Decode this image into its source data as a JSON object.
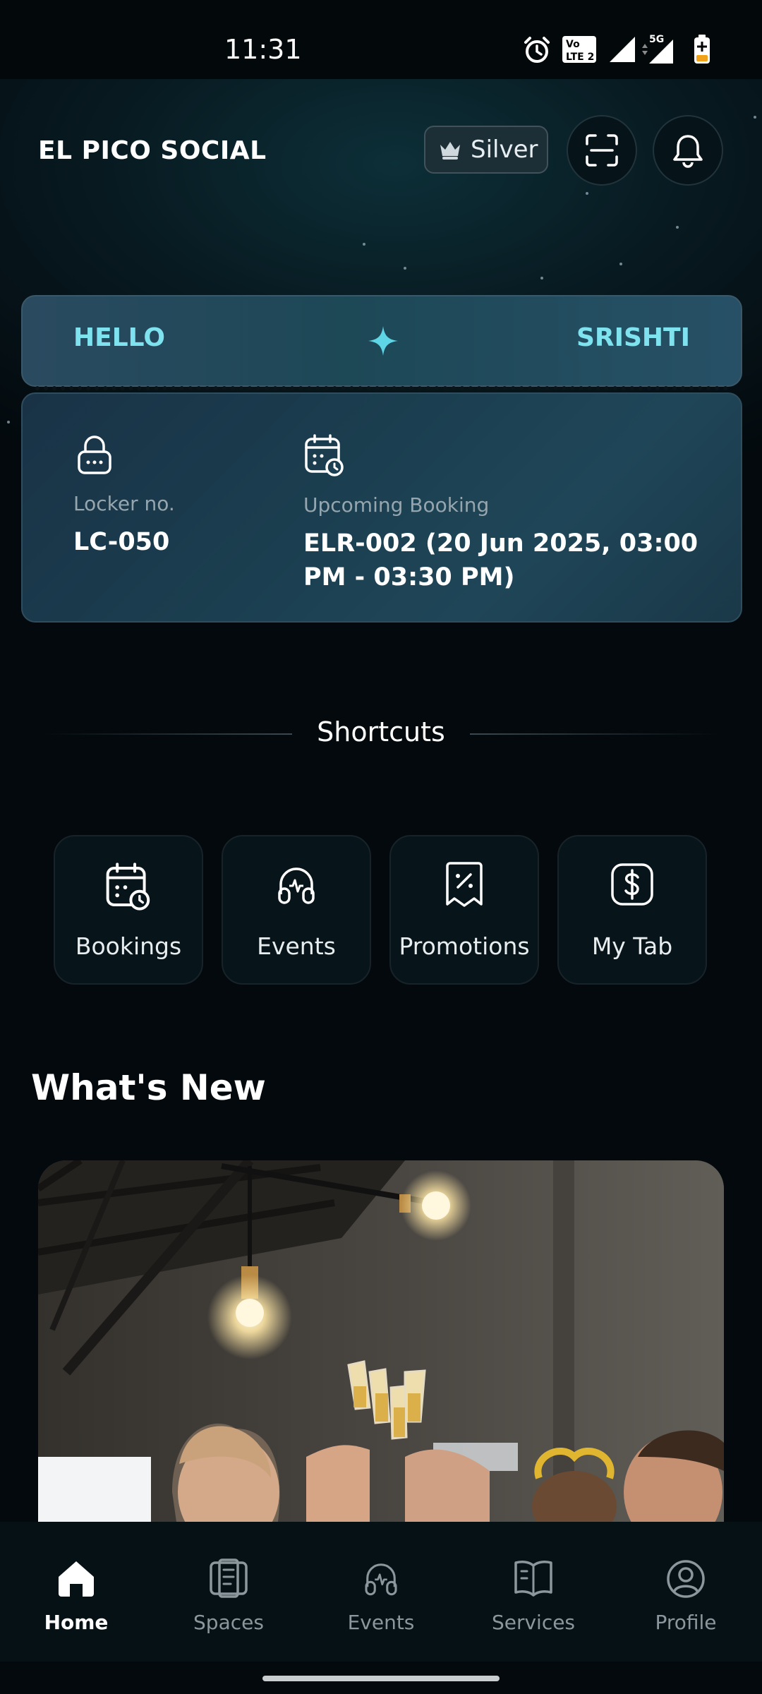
{
  "status_bar": {
    "time": "11:31",
    "network": "5G",
    "volte": "Vo LTE 2"
  },
  "header": {
    "brand": "EL PICO SOCIAL",
    "tier_label": "Silver"
  },
  "greeting": {
    "hello": "HELLO",
    "name": "SRISHTI"
  },
  "info": {
    "locker_label": "Locker no.",
    "locker_value": "LC-050",
    "booking_label": "Upcoming Booking",
    "booking_value": "ELR-002 (20 Jun 2025, 03:00 PM - 03:30 PM)"
  },
  "shortcuts": {
    "title": "Shortcuts",
    "items": [
      {
        "label": "Bookings",
        "icon": "calendar-clock-icon"
      },
      {
        "label": "Events",
        "icon": "events-icon"
      },
      {
        "label": "Promotions",
        "icon": "discount-ticket-icon"
      },
      {
        "label": "My Tab",
        "icon": "dollar-icon"
      }
    ]
  },
  "whats_new": {
    "title": "What's New"
  },
  "bottom_nav": {
    "items": [
      {
        "label": "Home",
        "icon": "home-icon",
        "active": true
      },
      {
        "label": "Spaces",
        "icon": "spaces-icon",
        "active": false
      },
      {
        "label": "Events",
        "icon": "events-icon",
        "active": false
      },
      {
        "label": "Services",
        "icon": "book-icon",
        "active": false
      },
      {
        "label": "Profile",
        "icon": "profile-icon",
        "active": false
      }
    ]
  },
  "colors": {
    "accent": "#7fe3ef",
    "background": "#03090d",
    "nav_active": "#ffffff",
    "nav_inactive": "#8b979c"
  }
}
